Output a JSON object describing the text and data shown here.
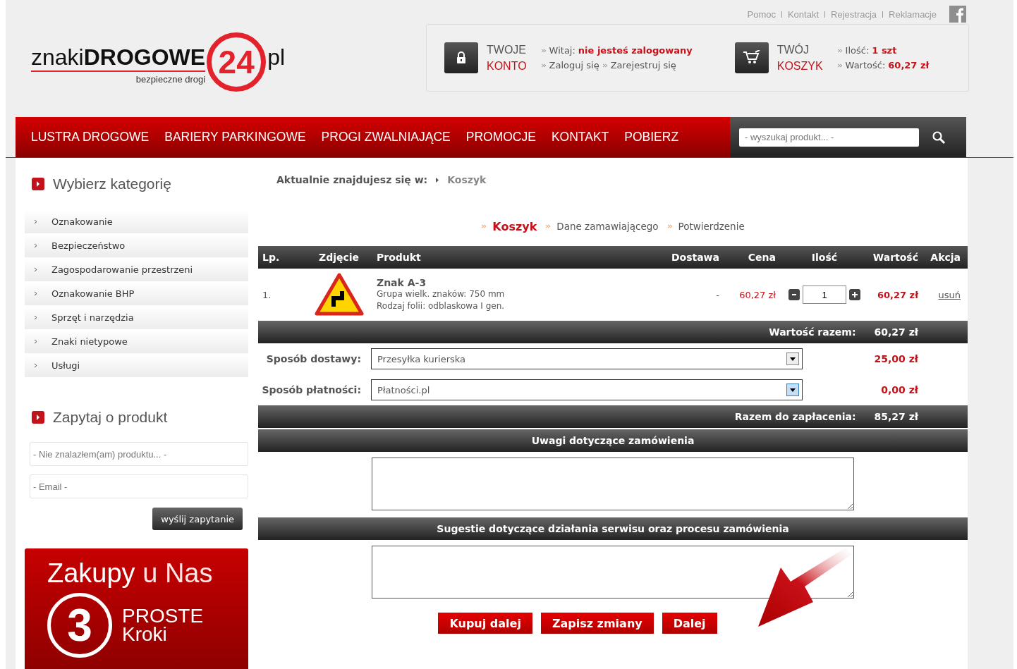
{
  "top_links": [
    "Pomoc",
    "Kontakt",
    "Rejestracja",
    "Reklamacje"
  ],
  "logo": {
    "prefix": "znaki",
    "bold": "DROGOWE",
    "number": "24",
    "suffix": "pl",
    "tagline": "bezpieczne drogi"
  },
  "account": {
    "title_1": "TWOJE",
    "title_2": "KONTO",
    "greeting_label": "Witaj:",
    "greeting_value": "nie jesteś zalogowany",
    "links": [
      "Zaloguj się",
      "Zarejestruj się"
    ]
  },
  "cart_summary": {
    "title_1": "TWÓJ",
    "title_2": "KOSZYK",
    "quantity_label": "Ilość:",
    "quantity_value": "1 szt",
    "value_label": "Wartość:",
    "value_value": "60,27 zł"
  },
  "nav": [
    "LUSTRA DROGOWE",
    "BARIERY PARKINGOWE",
    "PROGI ZWALNIAJĄCE",
    "PROMOCJE",
    "KONTAKT",
    "POBIERZ"
  ],
  "search": {
    "placeholder": "- wyszukaj produkt... -"
  },
  "sidebar": {
    "categories_title": "Wybierz kategorię",
    "categories": [
      "Oznakowanie",
      "Bezpieczeństwo",
      "Zagospodarowanie przestrzeni",
      "Oznakowanie BHP",
      "Sprzęt i narzędzia",
      "Znaki nietypowe",
      "Usługi"
    ],
    "ask_title": "Zapytaj o produkt",
    "ask_fields": [
      {
        "placeholder": "- Nie znalazłem(am) produktu... -"
      },
      {
        "placeholder": "- Email -"
      }
    ],
    "ask_button": "wyślij zapytanie",
    "promo": {
      "line_1a": "Zakupy",
      "line_1b": "u Nas",
      "number": "3",
      "line_2": "PROSTE",
      "line_3": "Kroki"
    }
  },
  "breadcrumb": {
    "label": "Aktualnie znajdujesz się w:",
    "current": "Koszyk"
  },
  "steps": [
    {
      "label": "Koszyk",
      "selected": true
    },
    {
      "label": "Dane zamawiającego",
      "selected": false
    },
    {
      "label": "Potwierdzenie",
      "selected": false
    }
  ],
  "table": {
    "columns": [
      "Lp.",
      "Zdjęcie",
      "Produkt",
      "Dostawa",
      "Cena",
      "Ilość",
      "Wartość",
      "Akcja"
    ],
    "rows": [
      {
        "lp": "1.",
        "name": "Znak A-3",
        "details": [
          "Grupa wielk. znaków: 750 mm",
          "Rodzaj folii: odblaskowa I gen."
        ],
        "delivery": "-",
        "price": "60,27 zł",
        "quantity": "1",
        "value": "60,27 zł",
        "action": "usuń"
      }
    ],
    "subtotal_label": "Wartość razem:",
    "subtotal": "60,27 zł"
  },
  "options": [
    {
      "label": "Sposób dostawy:",
      "value": "Przesyłka kurierska",
      "price": "25,00 zł",
      "focused": false
    },
    {
      "label": "Sposób płatności:",
      "value": "Płatności.pl",
      "price": "0,00 zł",
      "focused": true
    }
  ],
  "total": {
    "label": "Razem do zapłacenia:",
    "value": "85,27 zł"
  },
  "notes": [
    "Uwagi dotyczące zamówienia",
    "Sugestie dotyczące działania serwisu oraz procesu zamówienia"
  ],
  "buttons": [
    "Kupuj dalej",
    "Zapisz zmiany",
    "Dalej"
  ]
}
